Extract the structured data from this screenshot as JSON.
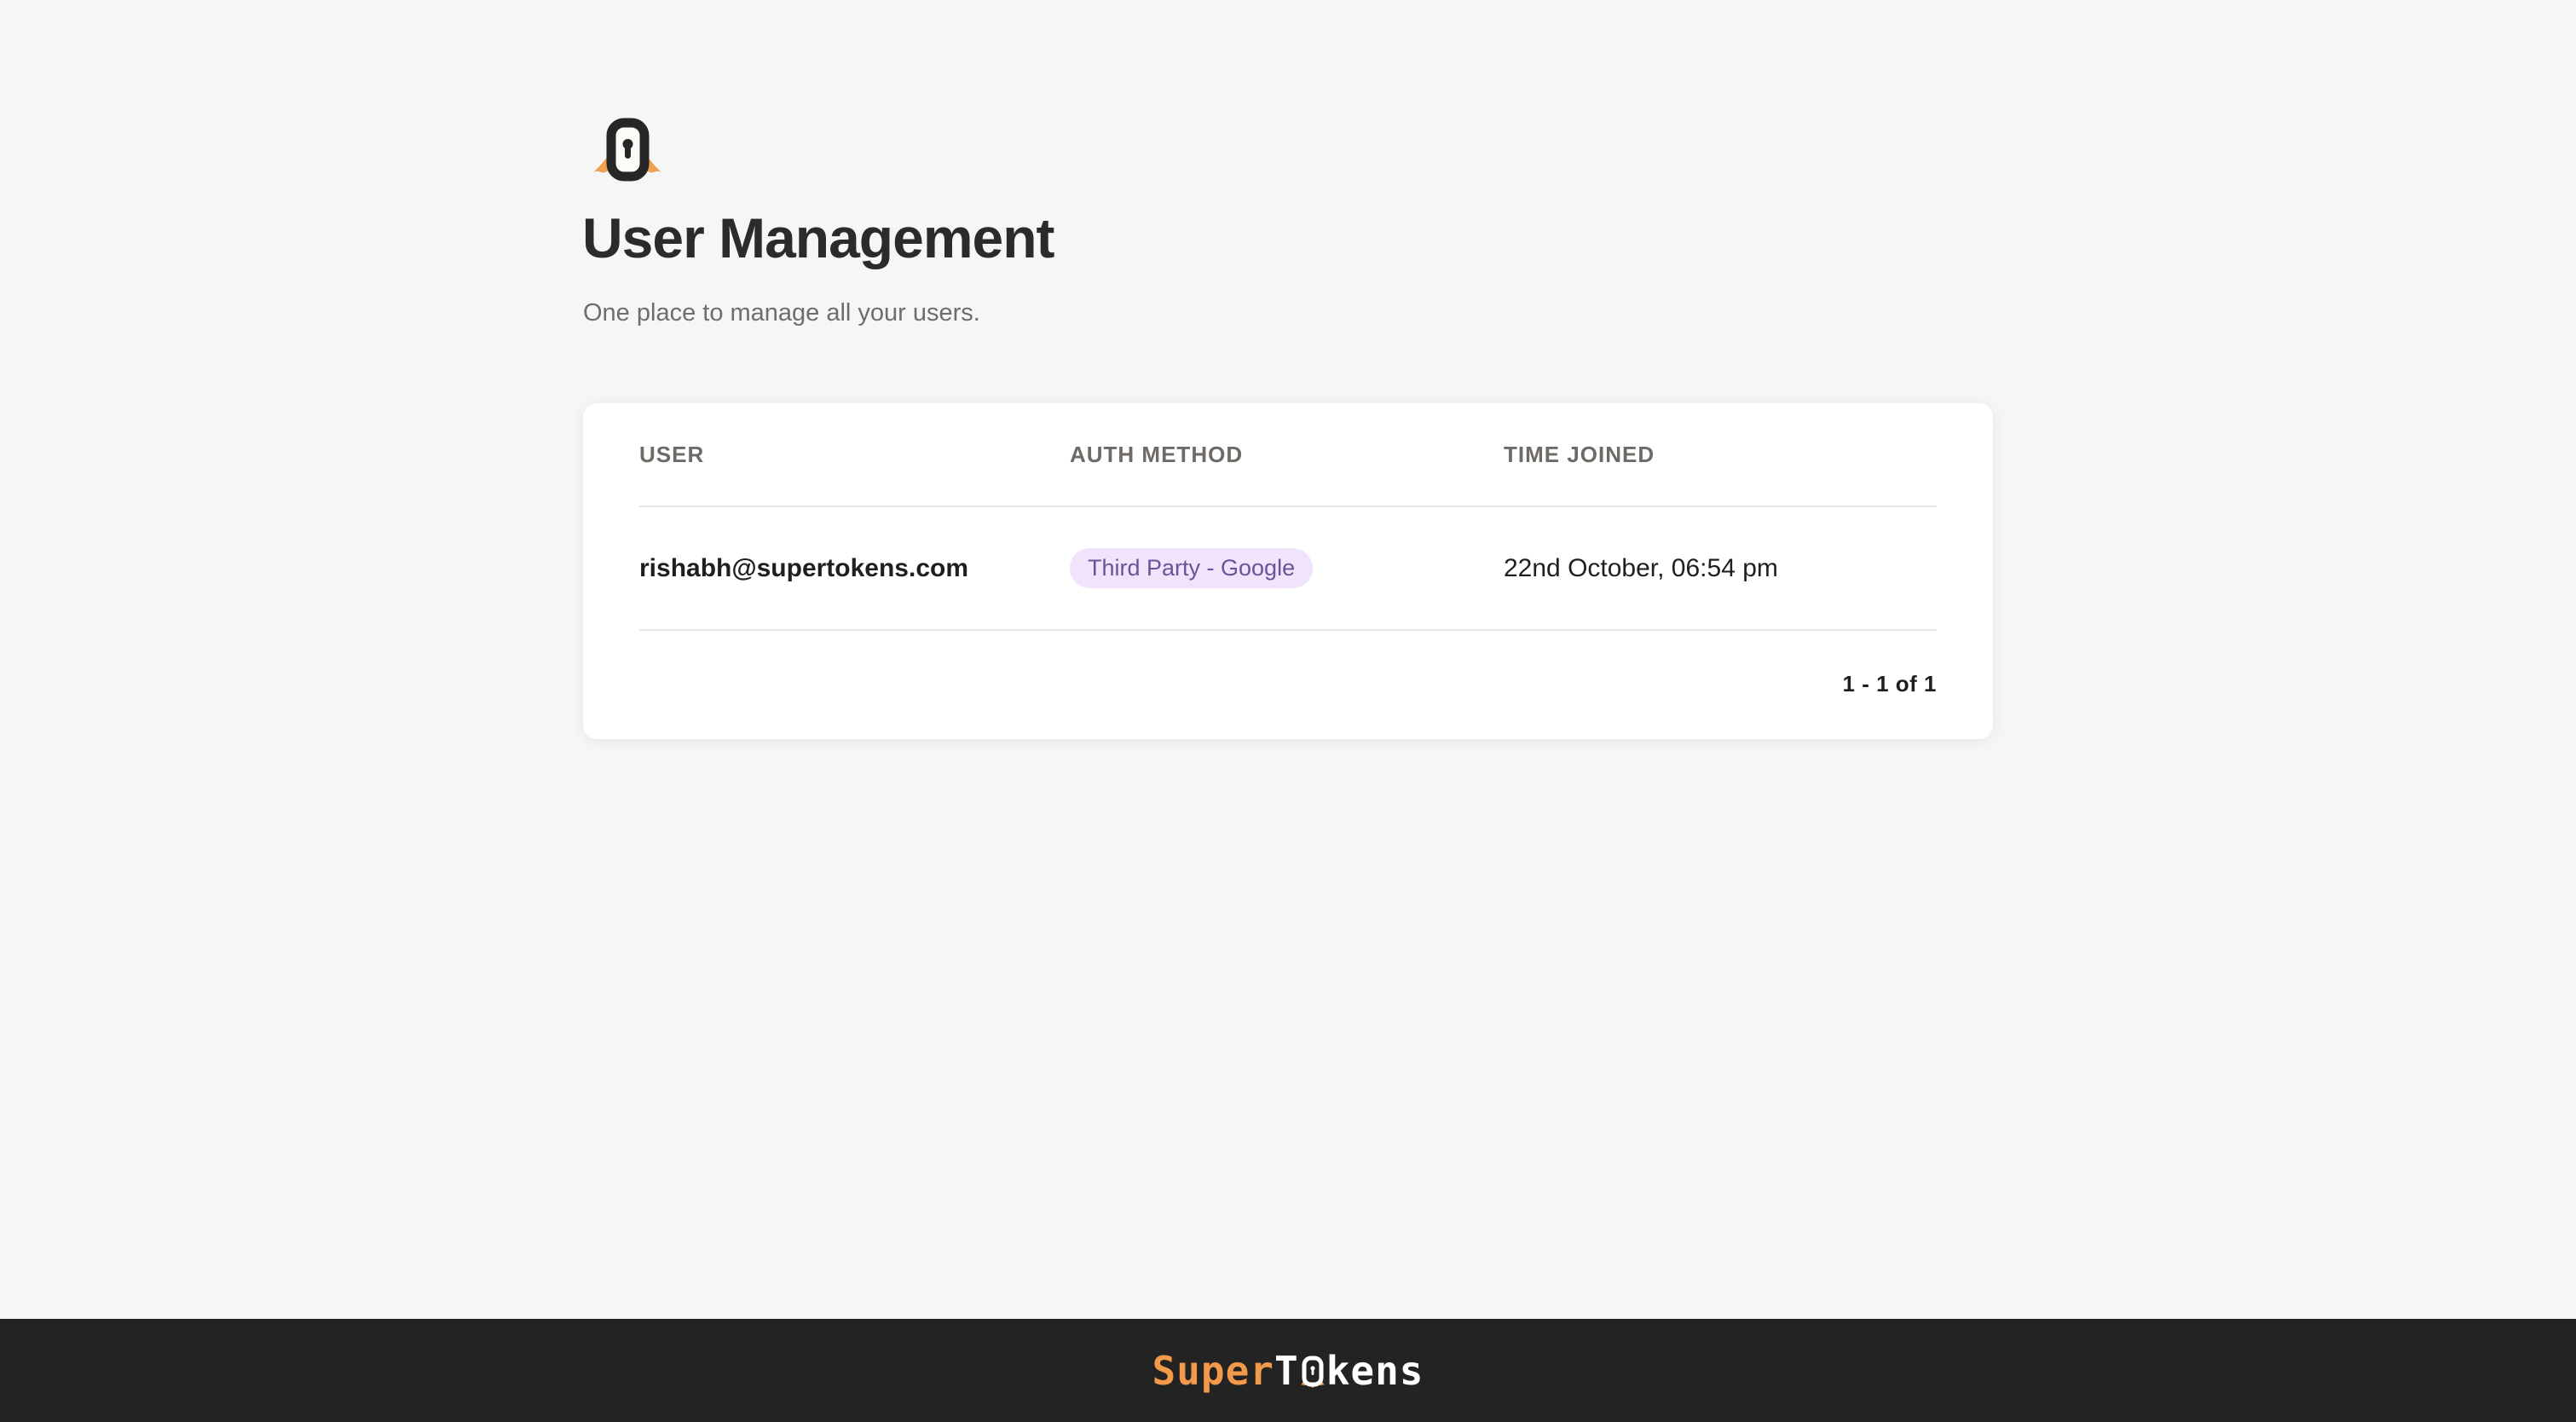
{
  "header": {
    "title": "User Management",
    "subtitle": "One place to manage all your users.",
    "logo_icon": "supertokens-lock-cape-icon"
  },
  "table": {
    "columns": [
      "USER",
      "AUTH METHOD",
      "TIME JOINED"
    ],
    "rows": [
      {
        "user": "rishabh@supertokens.com",
        "auth_method": "Third Party - Google",
        "time_joined": "22nd October, 06:54 pm"
      }
    ],
    "pagination": "1 - 1 of 1"
  },
  "footer": {
    "brand_super": "Super",
    "brand_t": "T",
    "brand_kens": "kens",
    "brand_lock_icon": "supertokens-lock-cape-icon"
  },
  "colors": {
    "page_background": "#f6f6f6",
    "card_background": "#ffffff",
    "accent_orange": "#f2994a",
    "cape_orange": "#f0a04e",
    "lock_dark": "#262626",
    "badge_background": "#f0e3fb",
    "badge_text": "#6a5397",
    "footer_background": "#232323",
    "heading_text": "#2b2b2b",
    "muted_text": "#6d6d6d",
    "column_header_text": "#6e6a66",
    "divider": "#e6e6e6"
  }
}
